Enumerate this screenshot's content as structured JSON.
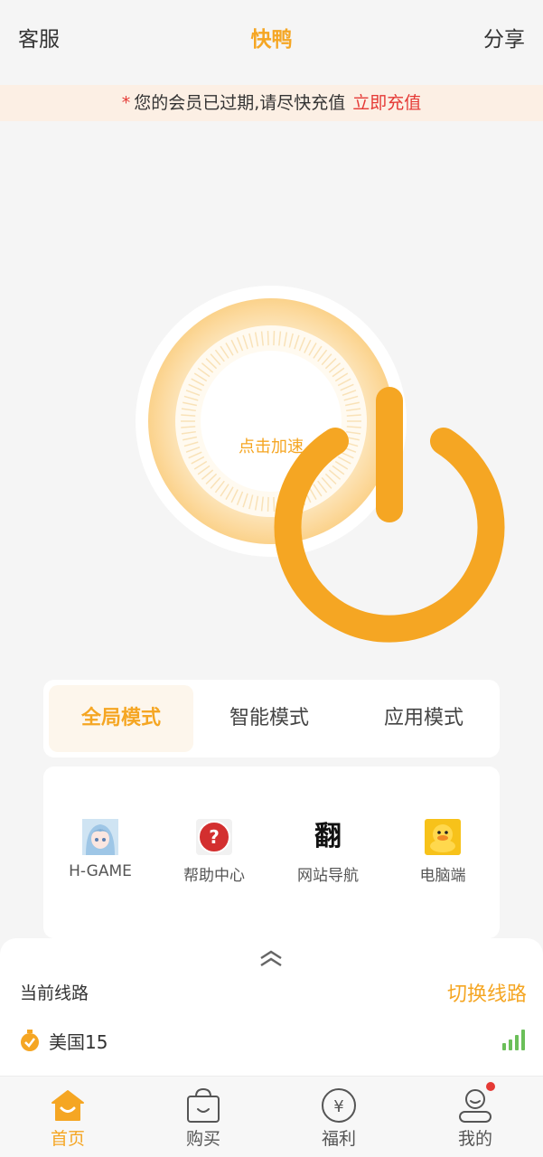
{
  "header": {
    "left": "客服",
    "title": "快鸭",
    "right": "分享"
  },
  "notice": {
    "star": "*",
    "text": "您的会员已过期,请尽快充值",
    "link": "立即充值"
  },
  "power": {
    "label": "点击加速"
  },
  "modes": [
    {
      "label": "全局模式",
      "active": true
    },
    {
      "label": "智能模式",
      "active": false
    },
    {
      "label": "应用模式",
      "active": false
    }
  ],
  "shortcuts": [
    {
      "label": "H-GAME",
      "icon": "anime-avatar-icon"
    },
    {
      "label": "帮助中心",
      "icon": "help-question-icon"
    },
    {
      "label": "网站导航",
      "icon": "fan-character-icon",
      "glyph": "翻"
    },
    {
      "label": "电脑端",
      "icon": "yellow-duck-icon"
    }
  ],
  "line": {
    "current_label": "当前线路",
    "switch_label": "切换线路",
    "server_name": "美国15",
    "signal": "signal-bars-icon"
  },
  "tabs": [
    {
      "label": "首页",
      "icon": "home-icon",
      "active": true
    },
    {
      "label": "购买",
      "icon": "shopping-bag-icon",
      "active": false
    },
    {
      "label": "福利",
      "icon": "yen-coin-icon",
      "glyph": "¥",
      "active": false
    },
    {
      "label": "我的",
      "icon": "profile-icon",
      "active": false,
      "badge": true
    }
  ],
  "colors": {
    "accent": "#f5a623",
    "alert": "#e53935",
    "notice_bg": "#fcefe4"
  }
}
